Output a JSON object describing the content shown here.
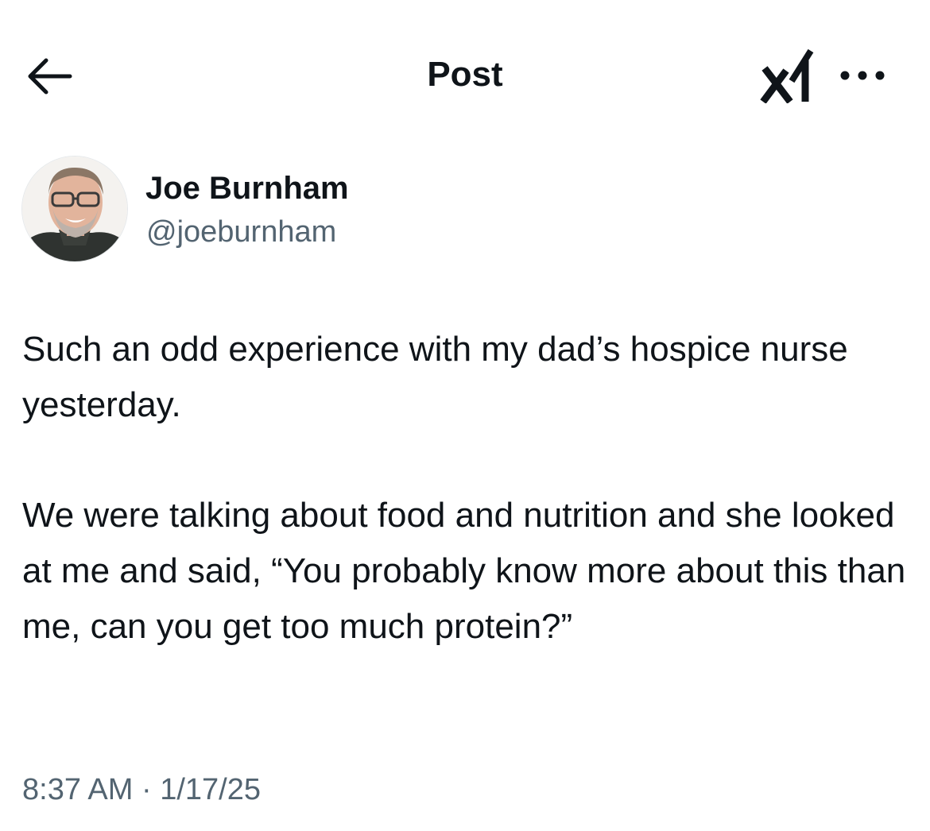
{
  "header": {
    "title": "Post",
    "back_icon": "arrow-left-icon",
    "grok_icon": "grok-logo-icon",
    "more_icon": "more-horizontal-icon"
  },
  "author": {
    "display_name": "Joe Burnham",
    "handle": "@joeburnham",
    "avatar_icon": "profile-photo"
  },
  "tweet": {
    "paragraphs": [
      "Such an odd experience with my dad’s hospice nurse yesterday.",
      "We were talking about food and nutrition and she looked at me and said, “You probably know more about this than me, can you get too much protein?”"
    ]
  },
  "meta": {
    "time": "8:37 AM",
    "separator": "·",
    "date": "1/17/25"
  },
  "colors": {
    "text_primary": "#0f1419",
    "text_secondary": "#536471",
    "background": "#ffffff"
  }
}
